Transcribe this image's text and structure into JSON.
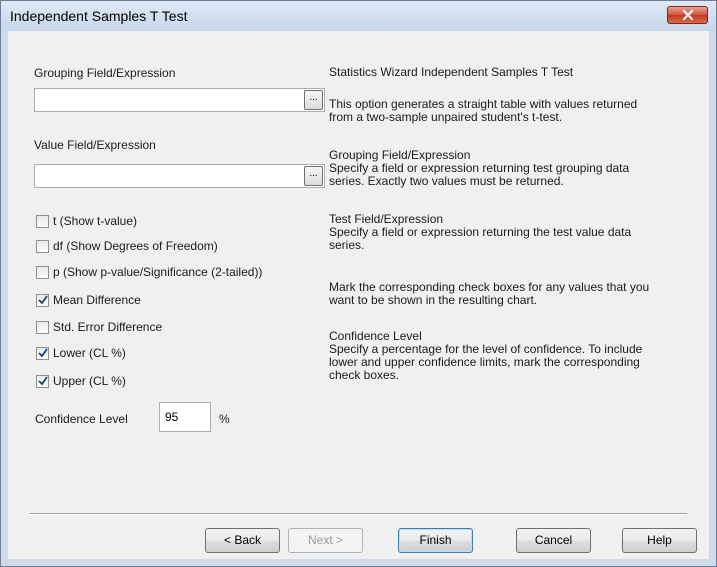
{
  "window": {
    "title": "Independent Samples T Test"
  },
  "form": {
    "grouping_label": "Grouping Field/Expression",
    "grouping_value": "",
    "value_label": "Value Field/Expression",
    "value_value": "",
    "browse_label": "...",
    "checkboxes": [
      {
        "label": "t (Show t-value)",
        "checked": false
      },
      {
        "label": "df (Show Degrees of Freedom)",
        "checked": false
      },
      {
        "label": "p (Show p-value/Significance (2-tailed))",
        "checked": false
      },
      {
        "label": "Mean Difference",
        "checked": true
      },
      {
        "label": "Std. Error Difference",
        "checked": false
      },
      {
        "label": "Lower (CL %)",
        "checked": true
      },
      {
        "label": "Upper (CL %)",
        "checked": true
      }
    ],
    "confidence_label": "Confidence Level",
    "confidence_value": "95",
    "confidence_unit": "%"
  },
  "help": {
    "heading": "Statistics Wizard Independent Samples T Test",
    "intro": [
      "This option generates a straight table with values returned",
      "from a two-sample unpaired student's t-test."
    ],
    "grouping_title": "Grouping Field/Expression",
    "grouping_body": [
      "Specify a field or expression returning test grouping data",
      "series. Exactly two values must be returned."
    ],
    "test_title": "Test Field/Expression",
    "test_body": [
      "Specify a field or expression returning the test value data",
      "series."
    ],
    "mark_body": [
      "Mark the corresponding check boxes for any values that you",
      "want to be shown in the resulting chart."
    ],
    "confidence_title": "Confidence Level",
    "confidence_body": [
      "Specify a percentage for the level of confidence. To include",
      "lower and upper confidence limits, mark the corresponding",
      "check boxes."
    ]
  },
  "buttons": {
    "back": "< Back",
    "next": "Next >",
    "finish": "Finish",
    "cancel": "Cancel",
    "help": "Help"
  },
  "colors": {
    "close_button": "#c94a35",
    "titlebar": "#cfdbe9",
    "dialog_bg": "#f0f0f0"
  }
}
